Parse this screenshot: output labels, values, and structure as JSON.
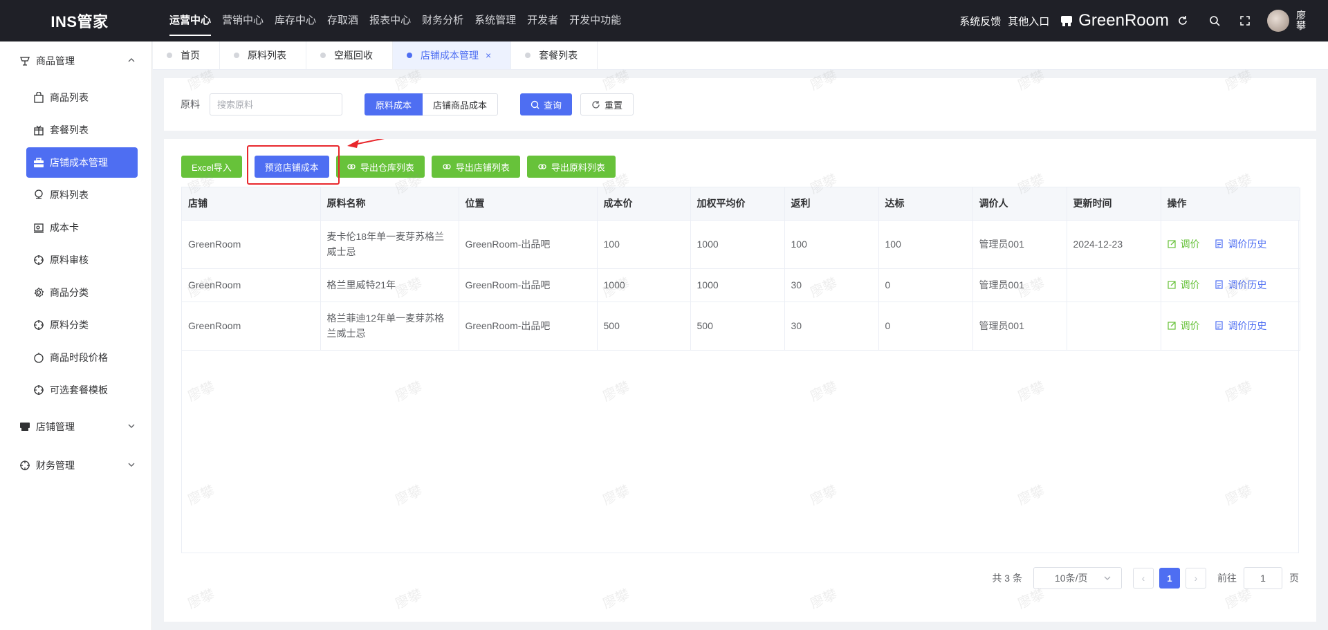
{
  "header": {
    "logo": "INS管家",
    "nav": [
      "运营中心",
      "营销中心",
      "库存中心",
      "存取酒",
      "报表中心",
      "财务分析",
      "系统管理",
      "开发者",
      "开发中功能"
    ],
    "active_nav": 0,
    "feedback": "系统反馈",
    "other_entry": "其他入口",
    "store_name": "GreenRoom",
    "user_name": "廖攀"
  },
  "sidebar": {
    "group1": {
      "label": "商品管理",
      "icon": "goods-icon"
    },
    "items": [
      {
        "label": "商品列表",
        "icon": "bag-icon"
      },
      {
        "label": "套餐列表",
        "icon": "gift-icon"
      },
      {
        "label": "店铺成本管理",
        "icon": "briefcase-icon"
      },
      {
        "label": "原料列表",
        "icon": "ingredient-icon"
      },
      {
        "label": "成本卡",
        "icon": "card-icon"
      },
      {
        "label": "原料审核",
        "icon": "target-icon"
      },
      {
        "label": "商品分类",
        "icon": "gear-icon"
      },
      {
        "label": "原料分类",
        "icon": "target-icon"
      },
      {
        "label": "商品时段价格",
        "icon": "apple-icon"
      },
      {
        "label": "可选套餐模板",
        "icon": "target-icon"
      }
    ],
    "active_item": 2,
    "group2": {
      "label": "店铺管理",
      "icon": "store-icon"
    },
    "group3": {
      "label": "财务管理",
      "icon": "target-icon"
    }
  },
  "tabs": [
    {
      "label": "首页",
      "active": false
    },
    {
      "label": "原料列表",
      "active": false
    },
    {
      "label": "空瓶回收",
      "active": false
    },
    {
      "label": "店铺成本管理",
      "active": true
    },
    {
      "label": "套餐列表",
      "active": false
    }
  ],
  "search": {
    "label": "原料",
    "placeholder": "搜索原料",
    "seg_left": "原料成本",
    "seg_right": "店铺商品成本",
    "query": "查询",
    "reset": "重置"
  },
  "toolbar": {
    "excel_import": "Excel导入",
    "preview": "预览店铺成本",
    "export_warehouse": "导出仓库列表",
    "export_store": "导出店铺列表",
    "export_material": "导出原料列表"
  },
  "table": {
    "columns": [
      "店铺",
      "原料名称",
      "位置",
      "成本价",
      "加权平均价",
      "返利",
      "达标",
      "调价人",
      "更新时间",
      "操作"
    ],
    "rows": [
      [
        "GreenRoom",
        "麦卡伦18年单一麦芽苏格兰威士忌",
        "GreenRoom-出品吧",
        "100",
        "1000",
        "100",
        "100",
        "管理员001",
        "2024-12-23"
      ],
      [
        "GreenRoom",
        "格兰里威特21年",
        "GreenRoom-出品吧",
        "1000",
        "1000",
        "30",
        "0",
        "管理员001",
        ""
      ],
      [
        "GreenRoom",
        "格兰菲迪12年单一麦芽苏格兰威士忌",
        "GreenRoom-出品吧",
        "500",
        "500",
        "30",
        "0",
        "管理员001",
        ""
      ]
    ],
    "op_adjust": "调价",
    "op_history": "调价历史"
  },
  "pagination": {
    "total": "共 3 条",
    "page_size": "10条/页",
    "current": "1",
    "goto_label": "前往",
    "goto_value": "1",
    "page_suffix": "页"
  },
  "watermark": "廖攀",
  "colors": {
    "primary": "#4e6ef2",
    "success": "#67c23a",
    "header_bg": "#1f2027",
    "annotation": "#e8272c"
  }
}
